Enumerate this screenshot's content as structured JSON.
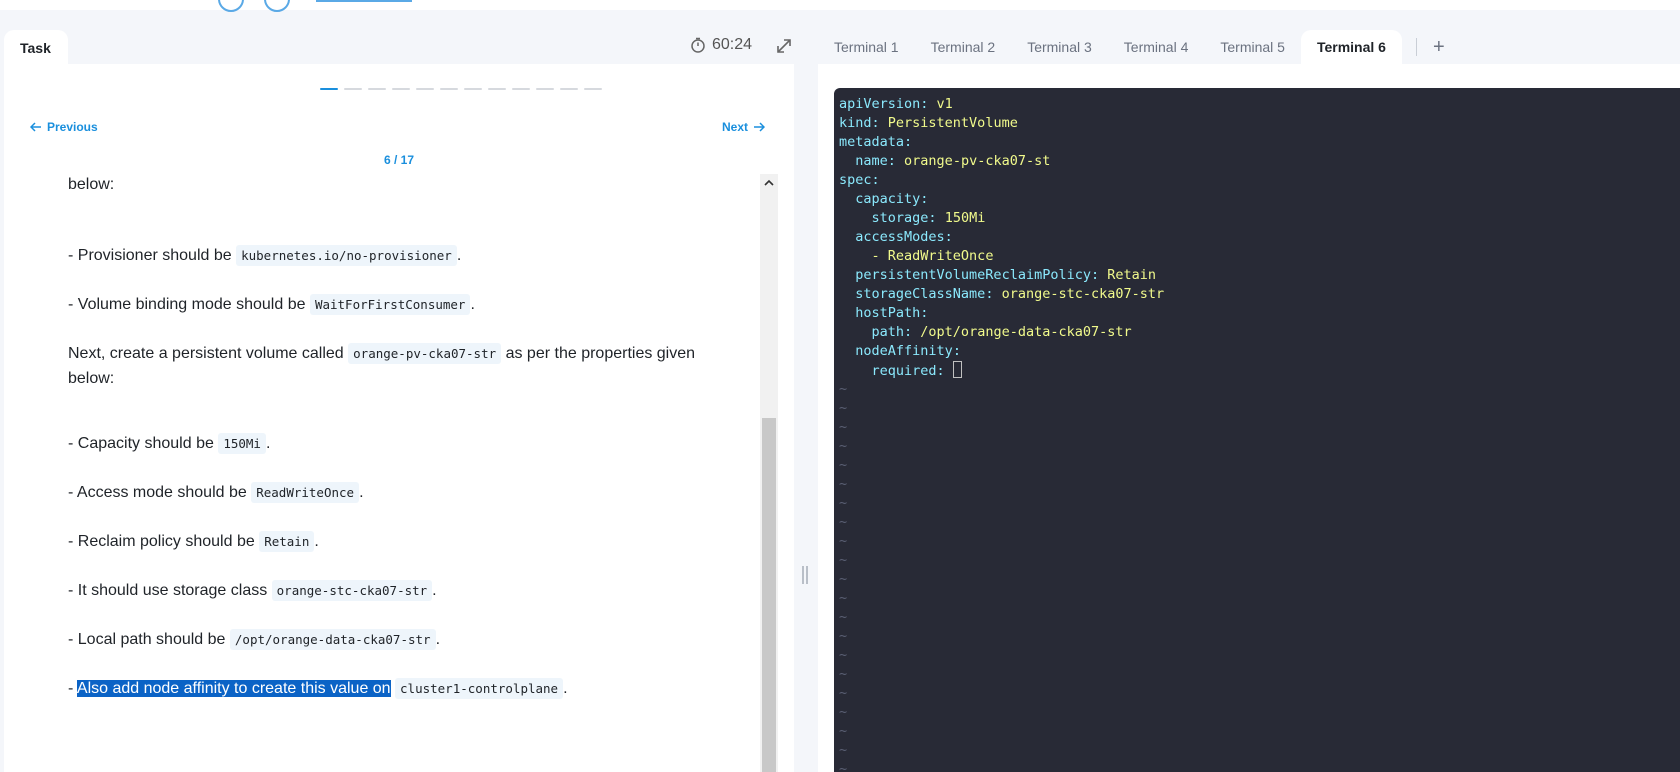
{
  "task_panel": {
    "tab_label": "Task",
    "timer": "60:24",
    "nav": {
      "previous_label": "Previous",
      "next_label": "Next"
    },
    "page_counter": "6 / 17",
    "progress": {
      "total_steps": 12,
      "current_step": 1
    },
    "content": {
      "cut_top_line": "below:",
      "items_sc": [
        {
          "text": "- Provisioner should be ",
          "code": "kubernetes.io/no-provisioner",
          "after": "."
        },
        {
          "text": "- Volume binding mode should be ",
          "code": "WaitForFirstConsumer",
          "after": "."
        }
      ],
      "pv_intro": {
        "text": "Next, create a persistent volume called ",
        "code": "orange-pv-cka07-str",
        "after": " as per the properties given below:"
      },
      "items_pv": [
        {
          "text": "- Capacity should be ",
          "code": "150Mi",
          "after": "."
        },
        {
          "text": "- Access mode should be ",
          "code": "ReadWriteOnce",
          "after": "."
        },
        {
          "text": "- Reclaim policy should be ",
          "code": "Retain",
          "after": "."
        },
        {
          "text": "- It should use storage class ",
          "code": "orange-stc-cka07-str",
          "after": "."
        },
        {
          "text": "- Local path should be ",
          "code": "/opt/orange-data-cka07-str",
          "after": "."
        }
      ],
      "last_item": {
        "prefix": "- ",
        "highlighted": "Also add node affinity to create this value on",
        "code": "cluster1-controlplane",
        "after": "."
      }
    }
  },
  "terminal": {
    "tabs": [
      "Terminal 1",
      "Terminal 2",
      "Terminal 3",
      "Terminal 4",
      "Terminal 5",
      "Terminal 6"
    ],
    "active_tab": "Terminal 6",
    "add_tab_label": "+",
    "lines": [
      {
        "indent": "",
        "key": "apiVersion",
        "sep": ": ",
        "value": "v1"
      },
      {
        "indent": "",
        "key": "kind",
        "sep": ": ",
        "value": "PersistentVolume"
      },
      {
        "indent": "",
        "key": "metadata",
        "sep": ":",
        "value": ""
      },
      {
        "indent": "  ",
        "key": "name",
        "sep": ": ",
        "value": "orange-pv-cka07-st"
      },
      {
        "indent": "",
        "key": "spec",
        "sep": ":",
        "value": ""
      },
      {
        "indent": "  ",
        "key": "capacity",
        "sep": ":",
        "value": ""
      },
      {
        "indent": "    ",
        "key": "storage",
        "sep": ": ",
        "value": "150Mi"
      },
      {
        "indent": "  ",
        "key": "accessModes",
        "sep": ":",
        "value": ""
      },
      {
        "indent": "    ",
        "key": "",
        "sep": "- ",
        "value": "ReadWriteOnce"
      },
      {
        "indent": "  ",
        "key": "persistentVolumeReclaimPolicy",
        "sep": ": ",
        "value": "Retain"
      },
      {
        "indent": "  ",
        "key": "storageClassName",
        "sep": ": ",
        "value": "orange-stc-cka07-str"
      },
      {
        "indent": "  ",
        "key": "hostPath",
        "sep": ":",
        "value": ""
      },
      {
        "indent": "    ",
        "key": "path",
        "sep": ": ",
        "value": "/opt/orange-data-cka07-str"
      },
      {
        "indent": "  ",
        "key": "nodeAffinity",
        "sep": ":",
        "value": ""
      },
      {
        "indent": "    ",
        "key": "required",
        "sep": ": ",
        "value": "",
        "cursor": true
      }
    ],
    "tilde_char": "~",
    "tilde_count": 21
  },
  "colors": {
    "accent": "#1a8fdd",
    "terminal_bg": "#282a36",
    "yaml_key": "#8be9fd",
    "yaml_value": "#f1fa8c",
    "selection": "#0b63c6"
  },
  "icons": {
    "timer": "stopwatch-icon",
    "expand": "expand-arrows-icon",
    "previous": "arrow-left-icon",
    "next": "arrow-right-icon",
    "scroll_up": "chevron-up-icon"
  }
}
